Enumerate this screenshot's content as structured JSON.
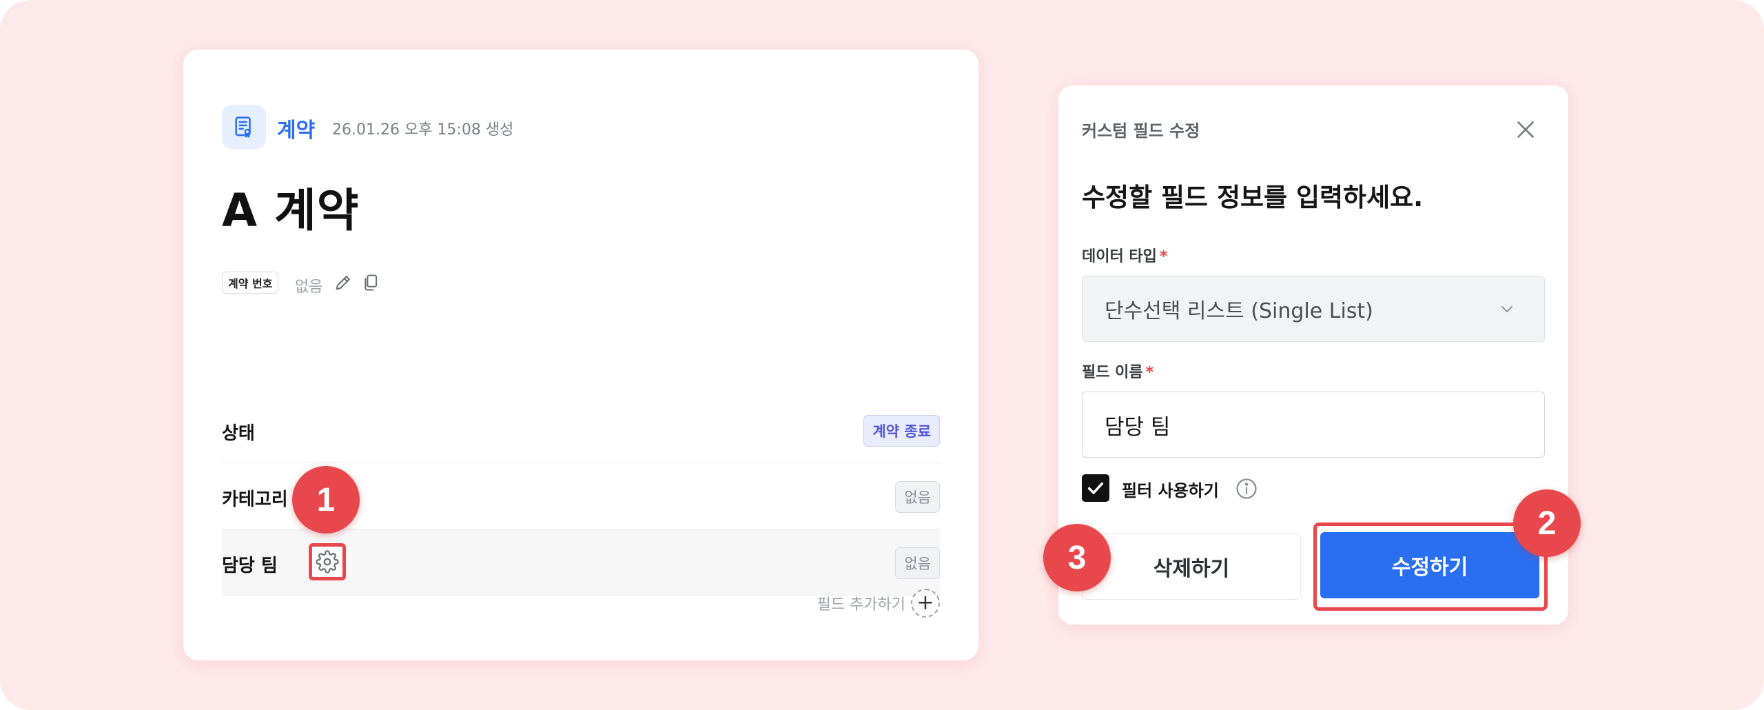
{
  "theme": {
    "accent": "#2a6ff2",
    "highlight_red": "#e8474b",
    "background": "#fee9e9",
    "tag_purple": "#4f56d8"
  },
  "record": {
    "type_label": "계약",
    "created_text": "26.01.26 오후 15:08 생성",
    "title": "A 계약",
    "number_field_label": "계약 번호",
    "number_field_value": "없음",
    "icons": [
      "document-icon",
      "pencil-icon",
      "copy-icon"
    ]
  },
  "properties": [
    {
      "label": "상태",
      "value": "계약 종료",
      "style": "purple"
    },
    {
      "label": "카테고리",
      "value": "없음",
      "style": "grey"
    },
    {
      "label": "담당 팀",
      "value": "없음",
      "style": "grey"
    }
  ],
  "add_field_label": "필드 추가하기",
  "modal": {
    "header": "커스텀 필드 수정",
    "heading": "수정할 필드 정보를 입력하세요.",
    "data_type_label": "데이터 타입",
    "data_type_value": "단수선택 리스트 (Single List)",
    "field_name_label": "필드 이름",
    "field_name_value": "담당 팀",
    "required_mark": "*",
    "filter_checkbox_label": "필터 사용하기",
    "filter_checked": true,
    "delete_button": "삭제하기",
    "save_button": "수정하기"
  },
  "steps": [
    "1",
    "2",
    "3"
  ]
}
